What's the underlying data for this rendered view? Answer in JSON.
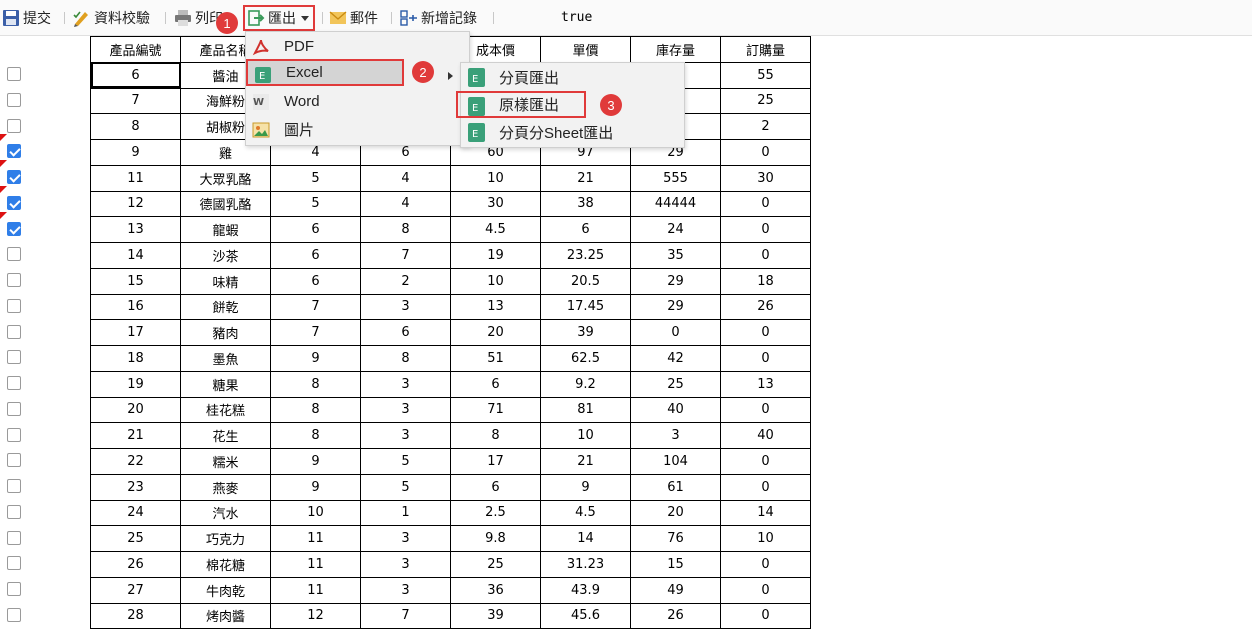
{
  "toolbar": {
    "submit_label": "提交",
    "validate_label": "資料校驗",
    "print_label": "列印",
    "export_label": "匯出",
    "mail_label": "郵件",
    "add_record_label": "新增記錄",
    "status_text": "true"
  },
  "export_menu": {
    "items": [
      {
        "label": "PDF",
        "icon": "pdf-icon"
      },
      {
        "label": "Excel",
        "icon": "excel-icon"
      },
      {
        "label": "Word",
        "icon": "word-icon"
      },
      {
        "label": "圖片",
        "icon": "image-icon"
      }
    ]
  },
  "excel_submenu": {
    "items": [
      {
        "label": "分頁匯出",
        "icon": "excel-icon"
      },
      {
        "label": "原樣匯出",
        "icon": "excel-icon"
      },
      {
        "label": "分頁分Sheet匯出",
        "icon": "excel-icon"
      }
    ]
  },
  "steps": [
    "1",
    "2",
    "3"
  ],
  "colors": {
    "accent_red": "#e03a3a",
    "checkbox_blue": "#2f7ee8"
  },
  "table": {
    "columns": [
      "產品編號",
      "產品名稱",
      "",
      "",
      "成本價",
      "單價",
      "庫存量",
      "訂購量"
    ],
    "rows": [
      {
        "id": "6",
        "name": "醬油",
        "c3": "",
        "c4": "",
        "cost": "",
        "price": "",
        "stock": "",
        "order": "55",
        "checked": false
      },
      {
        "id": "7",
        "name": "海鮮粉",
        "c3": "",
        "c4": "",
        "cost": "",
        "price": "",
        "stock": "",
        "order": "25",
        "checked": false
      },
      {
        "id": "8",
        "name": "胡椒粉",
        "c3": "",
        "c4": "",
        "cost": "",
        "price": "",
        "stock": "",
        "order": "2",
        "checked": false
      },
      {
        "id": "9",
        "name": "雞",
        "c3": "4",
        "c4": "6",
        "cost": "60",
        "price": "97",
        "stock": "29",
        "order": "0",
        "checked": true
      },
      {
        "id": "11",
        "name": "大眾乳酪",
        "c3": "5",
        "c4": "4",
        "cost": "10",
        "price": "21",
        "stock": "555",
        "order": "30",
        "checked": true
      },
      {
        "id": "12",
        "name": "德國乳酪",
        "c3": "5",
        "c4": "4",
        "cost": "30",
        "price": "38",
        "stock": "44444",
        "order": "0",
        "checked": true
      },
      {
        "id": "13",
        "name": "龍蝦",
        "c3": "6",
        "c4": "8",
        "cost": "4.5",
        "price": "6",
        "stock": "24",
        "order": "0",
        "checked": true
      },
      {
        "id": "14",
        "name": "沙茶",
        "c3": "6",
        "c4": "7",
        "cost": "19",
        "price": "23.25",
        "stock": "35",
        "order": "0",
        "checked": false
      },
      {
        "id": "15",
        "name": "味精",
        "c3": "6",
        "c4": "2",
        "cost": "10",
        "price": "20.5",
        "stock": "29",
        "order": "18",
        "checked": false
      },
      {
        "id": "16",
        "name": "餅乾",
        "c3": "7",
        "c4": "3",
        "cost": "13",
        "price": "17.45",
        "stock": "29",
        "order": "26",
        "checked": false
      },
      {
        "id": "17",
        "name": "豬肉",
        "c3": "7",
        "c4": "6",
        "cost": "20",
        "price": "39",
        "stock": "0",
        "order": "0",
        "checked": false
      },
      {
        "id": "18",
        "name": "墨魚",
        "c3": "9",
        "c4": "8",
        "cost": "51",
        "price": "62.5",
        "stock": "42",
        "order": "0",
        "checked": false
      },
      {
        "id": "19",
        "name": "糖果",
        "c3": "8",
        "c4": "3",
        "cost": "6",
        "price": "9.2",
        "stock": "25",
        "order": "13",
        "checked": false
      },
      {
        "id": "20",
        "name": "桂花糕",
        "c3": "8",
        "c4": "3",
        "cost": "71",
        "price": "81",
        "stock": "40",
        "order": "0",
        "checked": false
      },
      {
        "id": "21",
        "name": "花生",
        "c3": "8",
        "c4": "3",
        "cost": "8",
        "price": "10",
        "stock": "3",
        "order": "40",
        "checked": false
      },
      {
        "id": "22",
        "name": "糯米",
        "c3": "9",
        "c4": "5",
        "cost": "17",
        "price": "21",
        "stock": "104",
        "order": "0",
        "checked": false
      },
      {
        "id": "23",
        "name": "燕麥",
        "c3": "9",
        "c4": "5",
        "cost": "6",
        "price": "9",
        "stock": "61",
        "order": "0",
        "checked": false
      },
      {
        "id": "24",
        "name": "汽水",
        "c3": "10",
        "c4": "1",
        "cost": "2.5",
        "price": "4.5",
        "stock": "20",
        "order": "14",
        "checked": false
      },
      {
        "id": "25",
        "name": "巧克力",
        "c3": "11",
        "c4": "3",
        "cost": "9.8",
        "price": "14",
        "stock": "76",
        "order": "10",
        "checked": false
      },
      {
        "id": "26",
        "name": "棉花糖",
        "c3": "11",
        "c4": "3",
        "cost": "25",
        "price": "31.23",
        "stock": "15",
        "order": "0",
        "checked": false
      },
      {
        "id": "27",
        "name": "牛肉乾",
        "c3": "11",
        "c4": "3",
        "cost": "36",
        "price": "43.9",
        "stock": "49",
        "order": "0",
        "checked": false
      },
      {
        "id": "28",
        "name": "烤肉醬",
        "c3": "12",
        "c4": "7",
        "cost": "39",
        "price": "45.6",
        "stock": "26",
        "order": "0",
        "checked": false
      }
    ]
  }
}
